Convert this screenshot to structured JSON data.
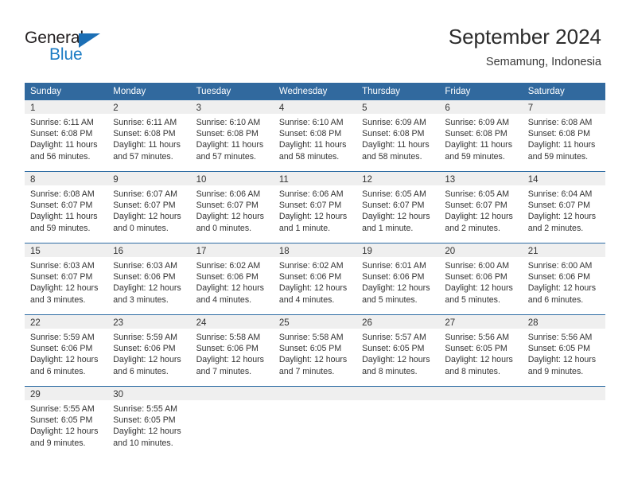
{
  "brand": {
    "name_top": "General",
    "name_bottom": "Blue",
    "color_dark": "#231f20",
    "color_blue": "#1c7cc4"
  },
  "header": {
    "title": "September 2024",
    "subtitle": "Semamung, Indonesia"
  },
  "theme": {
    "header_blue": "#31699e",
    "row_rule": "#2e6ca4",
    "day_band": "#efefef"
  },
  "weekdays": [
    "Sunday",
    "Monday",
    "Tuesday",
    "Wednesday",
    "Thursday",
    "Friday",
    "Saturday"
  ],
  "weeks": [
    [
      {
        "day": "1",
        "sunrise": "Sunrise: 6:11 AM",
        "sunset": "Sunset: 6:08 PM",
        "daylight1": "Daylight: 11 hours",
        "daylight2": "and 56 minutes."
      },
      {
        "day": "2",
        "sunrise": "Sunrise: 6:11 AM",
        "sunset": "Sunset: 6:08 PM",
        "daylight1": "Daylight: 11 hours",
        "daylight2": "and 57 minutes."
      },
      {
        "day": "3",
        "sunrise": "Sunrise: 6:10 AM",
        "sunset": "Sunset: 6:08 PM",
        "daylight1": "Daylight: 11 hours",
        "daylight2": "and 57 minutes."
      },
      {
        "day": "4",
        "sunrise": "Sunrise: 6:10 AM",
        "sunset": "Sunset: 6:08 PM",
        "daylight1": "Daylight: 11 hours",
        "daylight2": "and 58 minutes."
      },
      {
        "day": "5",
        "sunrise": "Sunrise: 6:09 AM",
        "sunset": "Sunset: 6:08 PM",
        "daylight1": "Daylight: 11 hours",
        "daylight2": "and 58 minutes."
      },
      {
        "day": "6",
        "sunrise": "Sunrise: 6:09 AM",
        "sunset": "Sunset: 6:08 PM",
        "daylight1": "Daylight: 11 hours",
        "daylight2": "and 59 minutes."
      },
      {
        "day": "7",
        "sunrise": "Sunrise: 6:08 AM",
        "sunset": "Sunset: 6:08 PM",
        "daylight1": "Daylight: 11 hours",
        "daylight2": "and 59 minutes."
      }
    ],
    [
      {
        "day": "8",
        "sunrise": "Sunrise: 6:08 AM",
        "sunset": "Sunset: 6:07 PM",
        "daylight1": "Daylight: 11 hours",
        "daylight2": "and 59 minutes."
      },
      {
        "day": "9",
        "sunrise": "Sunrise: 6:07 AM",
        "sunset": "Sunset: 6:07 PM",
        "daylight1": "Daylight: 12 hours",
        "daylight2": "and 0 minutes."
      },
      {
        "day": "10",
        "sunrise": "Sunrise: 6:06 AM",
        "sunset": "Sunset: 6:07 PM",
        "daylight1": "Daylight: 12 hours",
        "daylight2": "and 0 minutes."
      },
      {
        "day": "11",
        "sunrise": "Sunrise: 6:06 AM",
        "sunset": "Sunset: 6:07 PM",
        "daylight1": "Daylight: 12 hours",
        "daylight2": "and 1 minute."
      },
      {
        "day": "12",
        "sunrise": "Sunrise: 6:05 AM",
        "sunset": "Sunset: 6:07 PM",
        "daylight1": "Daylight: 12 hours",
        "daylight2": "and 1 minute."
      },
      {
        "day": "13",
        "sunrise": "Sunrise: 6:05 AM",
        "sunset": "Sunset: 6:07 PM",
        "daylight1": "Daylight: 12 hours",
        "daylight2": "and 2 minutes."
      },
      {
        "day": "14",
        "sunrise": "Sunrise: 6:04 AM",
        "sunset": "Sunset: 6:07 PM",
        "daylight1": "Daylight: 12 hours",
        "daylight2": "and 2 minutes."
      }
    ],
    [
      {
        "day": "15",
        "sunrise": "Sunrise: 6:03 AM",
        "sunset": "Sunset: 6:07 PM",
        "daylight1": "Daylight: 12 hours",
        "daylight2": "and 3 minutes."
      },
      {
        "day": "16",
        "sunrise": "Sunrise: 6:03 AM",
        "sunset": "Sunset: 6:06 PM",
        "daylight1": "Daylight: 12 hours",
        "daylight2": "and 3 minutes."
      },
      {
        "day": "17",
        "sunrise": "Sunrise: 6:02 AM",
        "sunset": "Sunset: 6:06 PM",
        "daylight1": "Daylight: 12 hours",
        "daylight2": "and 4 minutes."
      },
      {
        "day": "18",
        "sunrise": "Sunrise: 6:02 AM",
        "sunset": "Sunset: 6:06 PM",
        "daylight1": "Daylight: 12 hours",
        "daylight2": "and 4 minutes."
      },
      {
        "day": "19",
        "sunrise": "Sunrise: 6:01 AM",
        "sunset": "Sunset: 6:06 PM",
        "daylight1": "Daylight: 12 hours",
        "daylight2": "and 5 minutes."
      },
      {
        "day": "20",
        "sunrise": "Sunrise: 6:00 AM",
        "sunset": "Sunset: 6:06 PM",
        "daylight1": "Daylight: 12 hours",
        "daylight2": "and 5 minutes."
      },
      {
        "day": "21",
        "sunrise": "Sunrise: 6:00 AM",
        "sunset": "Sunset: 6:06 PM",
        "daylight1": "Daylight: 12 hours",
        "daylight2": "and 6 minutes."
      }
    ],
    [
      {
        "day": "22",
        "sunrise": "Sunrise: 5:59 AM",
        "sunset": "Sunset: 6:06 PM",
        "daylight1": "Daylight: 12 hours",
        "daylight2": "and 6 minutes."
      },
      {
        "day": "23",
        "sunrise": "Sunrise: 5:59 AM",
        "sunset": "Sunset: 6:06 PM",
        "daylight1": "Daylight: 12 hours",
        "daylight2": "and 6 minutes."
      },
      {
        "day": "24",
        "sunrise": "Sunrise: 5:58 AM",
        "sunset": "Sunset: 6:06 PM",
        "daylight1": "Daylight: 12 hours",
        "daylight2": "and 7 minutes."
      },
      {
        "day": "25",
        "sunrise": "Sunrise: 5:58 AM",
        "sunset": "Sunset: 6:05 PM",
        "daylight1": "Daylight: 12 hours",
        "daylight2": "and 7 minutes."
      },
      {
        "day": "26",
        "sunrise": "Sunrise: 5:57 AM",
        "sunset": "Sunset: 6:05 PM",
        "daylight1": "Daylight: 12 hours",
        "daylight2": "and 8 minutes."
      },
      {
        "day": "27",
        "sunrise": "Sunrise: 5:56 AM",
        "sunset": "Sunset: 6:05 PM",
        "daylight1": "Daylight: 12 hours",
        "daylight2": "and 8 minutes."
      },
      {
        "day": "28",
        "sunrise": "Sunrise: 5:56 AM",
        "sunset": "Sunset: 6:05 PM",
        "daylight1": "Daylight: 12 hours",
        "daylight2": "and 9 minutes."
      }
    ],
    [
      {
        "day": "29",
        "sunrise": "Sunrise: 5:55 AM",
        "sunset": "Sunset: 6:05 PM",
        "daylight1": "Daylight: 12 hours",
        "daylight2": "and 9 minutes."
      },
      {
        "day": "30",
        "sunrise": "Sunrise: 5:55 AM",
        "sunset": "Sunset: 6:05 PM",
        "daylight1": "Daylight: 12 hours",
        "daylight2": "and 10 minutes."
      },
      {
        "day": "",
        "sunrise": "",
        "sunset": "",
        "daylight1": "",
        "daylight2": ""
      },
      {
        "day": "",
        "sunrise": "",
        "sunset": "",
        "daylight1": "",
        "daylight2": ""
      },
      {
        "day": "",
        "sunrise": "",
        "sunset": "",
        "daylight1": "",
        "daylight2": ""
      },
      {
        "day": "",
        "sunrise": "",
        "sunset": "",
        "daylight1": "",
        "daylight2": ""
      },
      {
        "day": "",
        "sunrise": "",
        "sunset": "",
        "daylight1": "",
        "daylight2": ""
      }
    ]
  ]
}
